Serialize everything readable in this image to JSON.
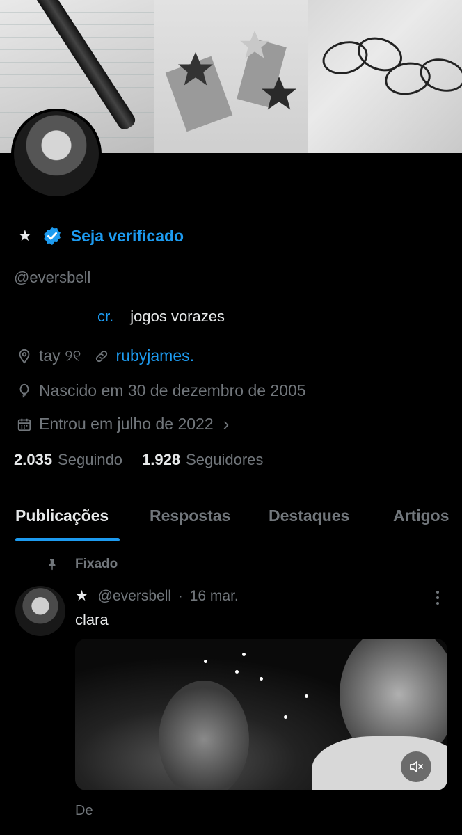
{
  "profile": {
    "star": "★",
    "verify_label": "Seja verificado",
    "handle": "@eversbell",
    "bio_prefix": "cr.",
    "bio_text": "jogos vorazes",
    "location": "tay ୨୧",
    "link": "rubyjames.",
    "birthday": "Nascido em 30 de dezembro de 2005",
    "joined": "Entrou em julho de 2022",
    "joined_chevron": "›",
    "following_count": "2.035",
    "following_label": "Seguindo",
    "followers_count": "1.928",
    "followers_label": "Seguidores"
  },
  "tabs": [
    {
      "label": "Publicações"
    },
    {
      "label": "Respostas"
    },
    {
      "label": "Destaques"
    },
    {
      "label": "Artigos"
    }
  ],
  "post": {
    "pinned_label": "Fixado",
    "star": "★",
    "handle": "@eversbell",
    "separator": "·",
    "date": "16 mar.",
    "text": "clara",
    "footer_text": "De"
  },
  "colors": {
    "accent": "#1d9bf0",
    "muted": "#71767b",
    "background": "#000000"
  }
}
